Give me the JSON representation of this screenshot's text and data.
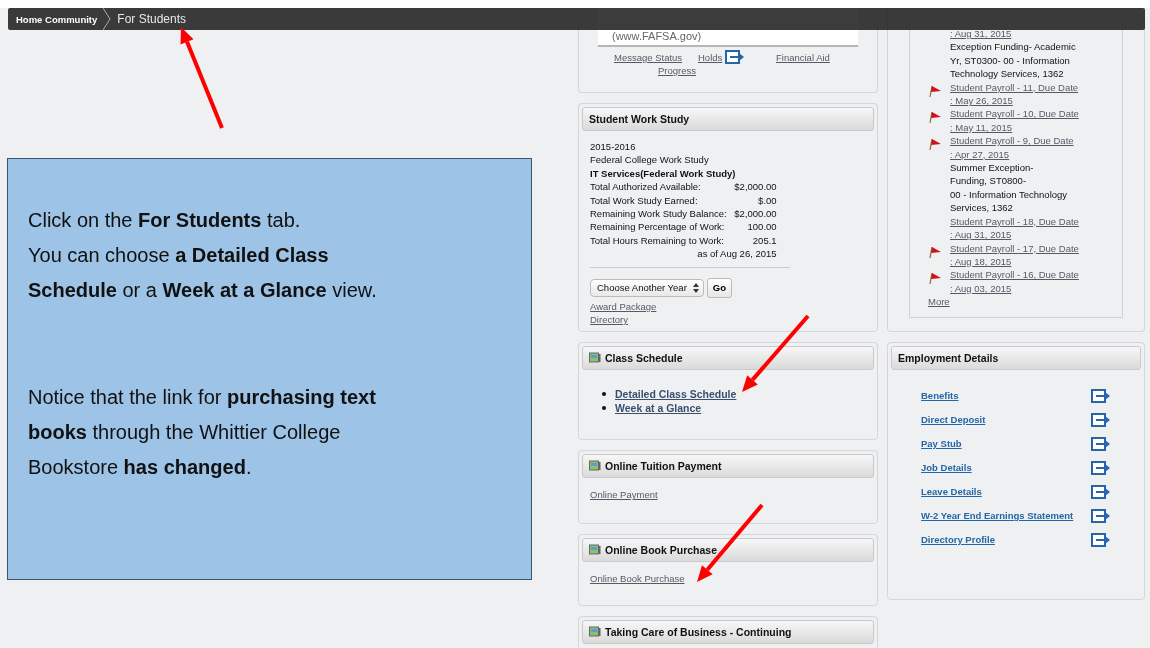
{
  "breadcrumb": [
    {
      "label": "Home Community",
      "selected": false
    },
    {
      "label": "For Students",
      "selected": true
    }
  ],
  "callout": {
    "paragraphs": [
      [
        "Click on the **For Students** tab.",
        "You can choose **a Detailed Class Schedule** or a **Week at a Glance** view."
      ],
      [
        "Notice that the link for **purchasing text books** through the Whittier College Bookstore **has changed**."
      ]
    ]
  },
  "aid_panel": {
    "lines": [
      "(www.FAFSA.gov)"
    ],
    "links": [
      {
        "label": "Message Status",
        "icon": false
      },
      {
        "label": "Holds",
        "icon": true
      },
      {
        "label": "Financial Aid",
        "icon": false
      },
      {
        "label": "Progress",
        "icon": false
      }
    ]
  },
  "work_study": {
    "title": "Student Work Study",
    "lines": [
      {
        "text": "2015-2016",
        "bold": false
      },
      {
        "text": "Federal College Work Study",
        "bold": false
      },
      {
        "text": "IT Services(Federal Work Study)",
        "bold": true
      }
    ],
    "rows": [
      {
        "label": "Total Authorized Available:",
        "value": "$2,000.00"
      },
      {
        "label": "Total Work Study Earned:",
        "value": "$.00"
      },
      {
        "label": "Remaining Work Study Balance:",
        "value": "$2,000.00"
      },
      {
        "label": "Remaining Percentage of Work:",
        "value": "100.00"
      },
      {
        "label": "Total Hours Remaining to Work:",
        "value": "205.1"
      }
    ],
    "as_of": "as of Aug 26, 2015",
    "select": "Choose Another Year",
    "go": "Go",
    "links": [
      "Award Package",
      "Directory"
    ]
  },
  "class_schedule": {
    "title": "Class Schedule",
    "links": [
      "Detailed Class Schedule",
      "Week at a Glance"
    ]
  },
  "tuition": {
    "title": "Online Tuition Payment",
    "link": "Online Payment"
  },
  "books": {
    "title": "Online Book Purchase",
    "link": "Online Book Purchase"
  },
  "business": {
    "title": "Taking Care of Business - Continuing"
  },
  "tasks": {
    "items": [
      {
        "kind": "link",
        "flagged": false,
        "lines": [
          ": Aug 31, 2015"
        ]
      },
      {
        "kind": "text",
        "flagged": false,
        "lines": [
          "Exception Funding- Academic",
          "Yr,  ST0300- 00  -  Information",
          "Technology Services, 1362"
        ]
      },
      {
        "kind": "link",
        "flagged": true,
        "lines": [
          "Student Payroll - 11, Due Date",
          ": May 26, 2015"
        ]
      },
      {
        "kind": "link",
        "flagged": true,
        "lines": [
          "Student Payroll - 10, Due Date",
          ": May 11, 2015"
        ]
      },
      {
        "kind": "link",
        "flagged": true,
        "lines": [
          "Student Payroll - 9, Due Date",
          ": Apr 27, 2015"
        ]
      },
      {
        "kind": "text",
        "flagged": false,
        "lines": [
          "Summer Exception-",
          "Funding,  ST0800-",
          "00  -  Information Technology",
          "Services, 1362"
        ]
      },
      {
        "kind": "link",
        "flagged": false,
        "lines": [
          "Student Payroll - 18, Due Date",
          ": Aug 31, 2015"
        ]
      },
      {
        "kind": "link",
        "flagged": true,
        "lines": [
          "Student Payroll - 17, Due Date",
          ": Aug 18, 2015"
        ]
      },
      {
        "kind": "link",
        "flagged": true,
        "lines": [
          "Student Payroll - 16, Due Date",
          ": Aug 03, 2015"
        ]
      }
    ],
    "more": "More"
  },
  "employment": {
    "title": "Employment Details",
    "links": [
      "Benefits",
      "Direct Deposit",
      "Pay Stub",
      "Job Details",
      "Leave Details",
      "W-2 Year End Earnings Statement",
      "Directory Profile"
    ]
  }
}
